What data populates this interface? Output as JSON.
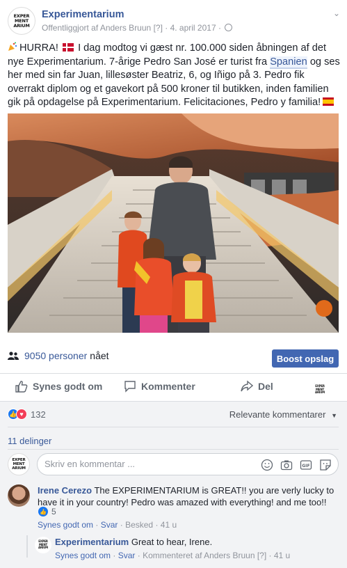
{
  "post": {
    "page_name": "Experimentarium",
    "logo_text": [
      "EXPER",
      "MENT",
      "ARIUM"
    ],
    "published_by": "Offentliggjort af Anders Bruun",
    "help_marker": "[?]",
    "date": "4. april 2017",
    "privacy_icon": "globe-icon",
    "text_part1": "HURRA!",
    "text_part2": "I dag modtog vi gæst nr. 100.000 siden åbningen af det nye Experimentarium. 7-årige Pedro San José er turist fra",
    "text_tag": "Spanien",
    "text_part3": "og ses her med sin far Juan, lillesøster Beatriz, 6, og Iñigo på 3. Pedro fik overrakt diplom og et gavekort på 500 kroner til butikken, inden familien gik på opdagelse på Experimentarium. Felicitaciones, Pedro y familia!"
  },
  "insights": {
    "reach_count": "9050 personer",
    "reach_suffix": "nået",
    "boost_label": "Boost opslag"
  },
  "actions": {
    "like": "Synes godt om",
    "comment": "Kommenter",
    "share": "Del"
  },
  "reactions": {
    "count": "132",
    "sort_label": "Relevante kommentarer",
    "shares": "11 delinger"
  },
  "composer": {
    "placeholder": "Skriv en kommentar ..."
  },
  "comments": [
    {
      "author": "Irene Cerezo",
      "text": "The EXPERIMENTARIUM is GREAT!! you are verly lucky to have it in your country! Pedro was amazed with everything! and me too!!",
      "likes": "5",
      "like_link": "Synes godt om",
      "reply_link": "Svar",
      "message_link": "Besked",
      "time": "41 u"
    }
  ],
  "reply": {
    "author": "Experimentarium",
    "text": "Great to hear, Irene.",
    "like_link": "Synes godt om",
    "reply_link": "Svar",
    "commented_by": "Kommenteret af Anders Bruun",
    "help_marker": "[?]",
    "time": "41 u"
  },
  "colors": {
    "link": "#385898",
    "boost": "#4267b2",
    "like_reaction": "#1877f2",
    "love_reaction": "#f33e58"
  }
}
